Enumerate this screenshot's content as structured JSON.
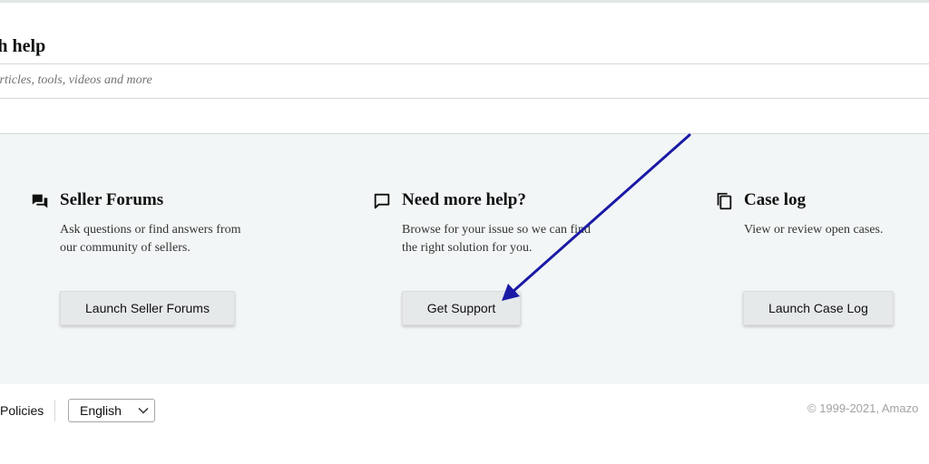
{
  "search": {
    "heading": "rch help",
    "placeholder": "o articles, tools, videos and more"
  },
  "cards": [
    {
      "title": "Seller Forums",
      "description": "Ask questions or find answers from our community of sellers.",
      "button_label": "Launch Seller Forums",
      "icon": "forum-icon"
    },
    {
      "title": "Need more help?",
      "description": "Browse for your issue so we can find the right solution for you.",
      "button_label": "Get Support",
      "icon": "chat-bubble-icon"
    },
    {
      "title": "Case log",
      "description": "View or review open cases.",
      "button_label": "Launch Case Log",
      "icon": "copy-documents-icon"
    }
  ],
  "footer": {
    "policies_label": "Policies",
    "language_selected": "English",
    "copyright": "© 1999-2021, Amazo"
  },
  "colors": {
    "panel_bg": "#f3f6f6",
    "button_bg": "#e6e9ea",
    "arrow": "#1a1aa6"
  }
}
